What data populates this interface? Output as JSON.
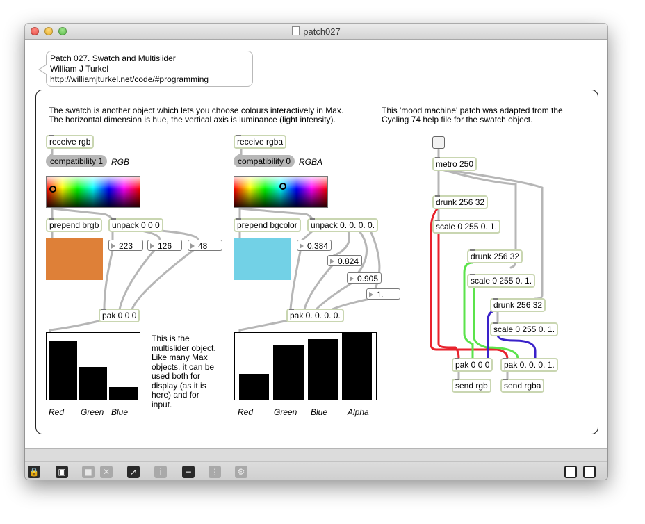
{
  "window": {
    "title": "patch027"
  },
  "header_comment": {
    "line1": "Patch 027. Swatch and Multislider",
    "line2": "William J Turkel",
    "line3": "http://williamjturkel.net/code/#programming"
  },
  "intro": {
    "line1": "The swatch is another object which lets you choose colours interactively in Max.",
    "line2": "The horizontal dimension is hue, the vertical axis is luminance (light intensity)."
  },
  "mood_comment": {
    "line1": "This 'mood machine' patch was adapted from the",
    "line2": "Cycling 74 help file for the swatch object."
  },
  "rgb_section": {
    "receive": "receive rgb",
    "compat": "compatibility 1",
    "compat_label": "RGB",
    "prepend": "prepend brgb",
    "unpack": "unpack 0 0 0",
    "numbers": [
      "223",
      "126",
      "48"
    ],
    "pak": "pak 0 0 0",
    "color_panel": "#de8038",
    "knob_fill": "#de8038",
    "slider_labels": [
      "Red",
      "Green",
      "Blue"
    ],
    "slider_values": [
      0.875,
      0.494,
      0.188
    ],
    "note": [
      "This is the",
      "multislider object.",
      "Like many Max",
      "objects, it can be",
      "used both for",
      "display (as it is",
      "here) and for",
      "input."
    ]
  },
  "rgba_section": {
    "receive": "receive rgba",
    "compat": "compatibility 0",
    "compat_label": "RGBA",
    "prepend": "prepend bgcolor",
    "unpack": "unpack 0. 0. 0. 0.",
    "numbers": [
      "0.384",
      "0.824",
      "0.905",
      "1."
    ],
    "pak": "pak 0. 0. 0. 0.",
    "color_panel": "#72d1e6",
    "knob_fill": "#72d1e6",
    "slider_labels": [
      "Red",
      "Green",
      "Blue",
      "Alpha"
    ],
    "slider_values": [
      0.384,
      0.824,
      0.905,
      1.0
    ]
  },
  "mood": {
    "metro": "metro 250",
    "drunk1": "drunk 256 32",
    "scale1": "scale 0 255 0. 1.",
    "drunk2": "drunk 256 32",
    "scale2": "scale 0 255 0. 1.",
    "drunk3": "drunk 256 32",
    "scale3": "scale 0 255 0. 1.",
    "pak_rgb": "pak 0 0 0",
    "pak_rgba": "pak 0. 0. 0. 1.",
    "send_rgb": "send rgb",
    "send_rgba": "send rgba",
    "wire_colors": {
      "red": "#e8232d",
      "green": "#5be34b",
      "blue": "#3a22c9"
    }
  },
  "toolbar": {
    "icons": [
      "lock-icon",
      "presentation-icon",
      "clear-icon",
      "close-icon",
      "patcher-icon",
      "info-icon",
      "slider-icon",
      "grid-icon",
      "extras-icon",
      "split-horizontal-icon",
      "split-vertical-icon"
    ]
  }
}
